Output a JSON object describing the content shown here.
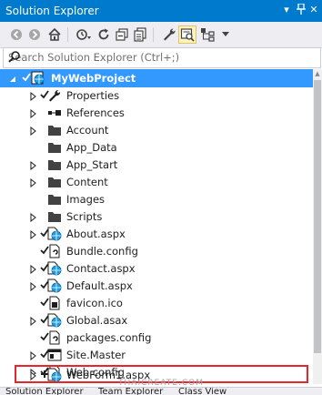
{
  "titlebar": {
    "title": "Solution Explorer",
    "pin_glyph": "▾",
    "close_glyph": "✕"
  },
  "toolbar": {
    "buttons": [
      {
        "icon": "back-icon"
      },
      {
        "icon": "forward-icon"
      },
      {
        "icon": "home-icon"
      },
      {
        "icon": "history-icon"
      },
      {
        "icon": "refresh-icon"
      },
      {
        "icon": "collapse-all-icon"
      },
      {
        "icon": "show-all-files-icon"
      },
      {
        "icon": "properties-icon"
      },
      {
        "icon": "preview-icon",
        "active": true
      },
      {
        "icon": "class-view-icon"
      },
      {
        "icon": "dropdown-icon"
      }
    ]
  },
  "search": {
    "placeholder": "Search Solution Explorer (Ctrl+;)"
  },
  "tree": {
    "items": [
      {
        "label": "MyWebProject",
        "icon": "web-project-icon",
        "expander": "expanded",
        "checked": true,
        "selected": true
      },
      {
        "label": "Properties",
        "icon": "wrench-icon",
        "expander": "collapsed",
        "checked": true
      },
      {
        "label": "References",
        "icon": "references-icon",
        "expander": "collapsed"
      },
      {
        "label": "Account",
        "icon": "folder-icon",
        "expander": "collapsed"
      },
      {
        "label": "App_Data",
        "icon": "folder-icon"
      },
      {
        "label": "App_Start",
        "icon": "folder-icon",
        "expander": "collapsed"
      },
      {
        "label": "Content",
        "icon": "folder-icon",
        "expander": "collapsed"
      },
      {
        "label": "Images",
        "icon": "folder-icon"
      },
      {
        "label": "Scripts",
        "icon": "folder-icon",
        "expander": "collapsed"
      },
      {
        "label": "About.aspx",
        "icon": "aspx-icon",
        "expander": "collapsed",
        "checked": true
      },
      {
        "label": "Bundle.config",
        "icon": "config-icon",
        "checked": true
      },
      {
        "label": "Contact.aspx",
        "icon": "aspx-icon",
        "expander": "collapsed",
        "checked": true
      },
      {
        "label": "Default.aspx",
        "icon": "aspx-icon",
        "expander": "collapsed",
        "checked": true
      },
      {
        "label": "favicon.ico",
        "icon": "ico-file-icon",
        "checked": true
      },
      {
        "label": "Global.asax",
        "icon": "asax-icon",
        "expander": "collapsed",
        "checked": true
      },
      {
        "label": "packages.config",
        "icon": "config-icon",
        "checked": true
      },
      {
        "label": "Site.Master",
        "icon": "master-icon",
        "expander": "collapsed",
        "checked": true
      },
      {
        "label": "Web.config",
        "icon": "config-icon",
        "expander": "collapsed",
        "checked": true
      },
      {
        "label": "WebForm1.aspx",
        "icon": "aspx-icon",
        "expander": "collapsed",
        "added": true
      }
    ]
  },
  "bottom_tabs": [
    "Solution Explorer",
    "Team Explorer",
    "Class View"
  ],
  "watermark": "THAICREATE.COM",
  "colors": {
    "accent": "#007acc",
    "selection": "#3399ff",
    "checkmark": "#1e1e1e",
    "added": "#1e1e1e",
    "highlight_box": "#e8262a",
    "folder": "#dcb67a"
  }
}
